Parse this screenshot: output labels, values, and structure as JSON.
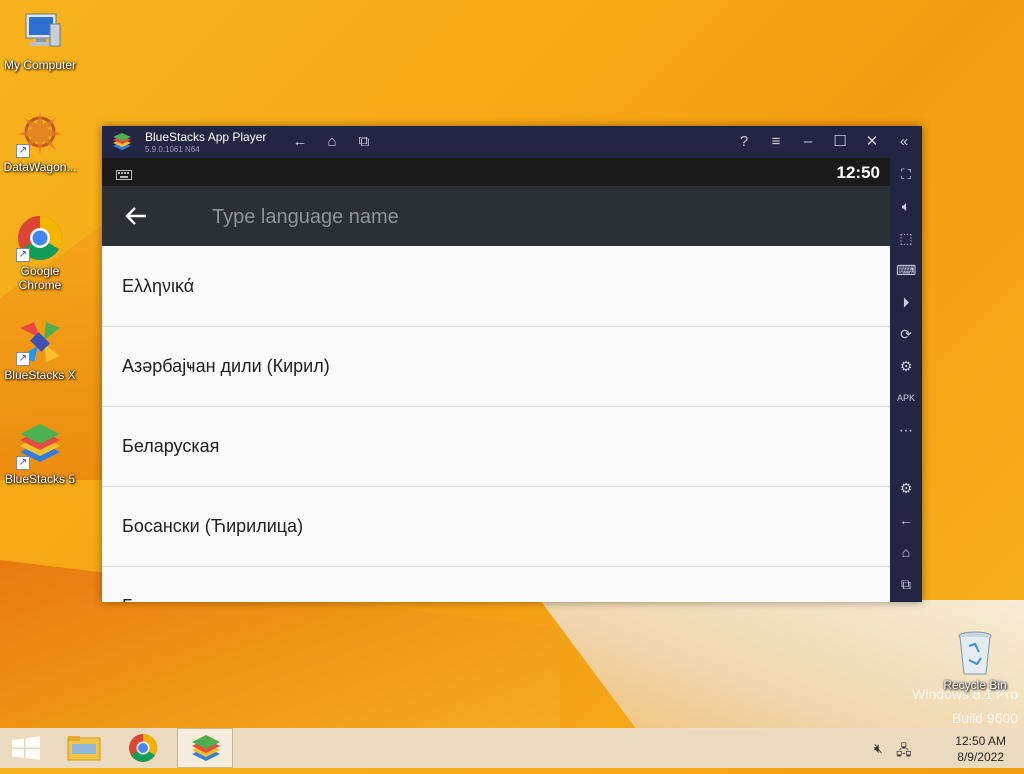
{
  "desktop": {
    "icons": [
      {
        "label": "My Computer"
      },
      {
        "label": "DataWagon..."
      },
      {
        "label": "Google Chrome"
      },
      {
        "label": "BlueStacks X"
      },
      {
        "label": "BlueStacks 5"
      },
      {
        "label": "Recycle Bin"
      }
    ],
    "watermark": {
      "line1": "Windows 8.1 Pro",
      "line2": "Build 9600"
    }
  },
  "bluestacks": {
    "title": "BlueStacks App Player",
    "version": "5.9.0.1061 N64",
    "status_time": "12:50",
    "search_placeholder": "Type language name",
    "languages": [
      "Ελληνικά",
      "Азәрбајҹан дили (Кирил)",
      "Беларуская",
      "Босански (Ћирилица)",
      "Български"
    ]
  },
  "taskbar": {
    "clock_time": "12:50 AM",
    "clock_date": "8/9/2022"
  }
}
